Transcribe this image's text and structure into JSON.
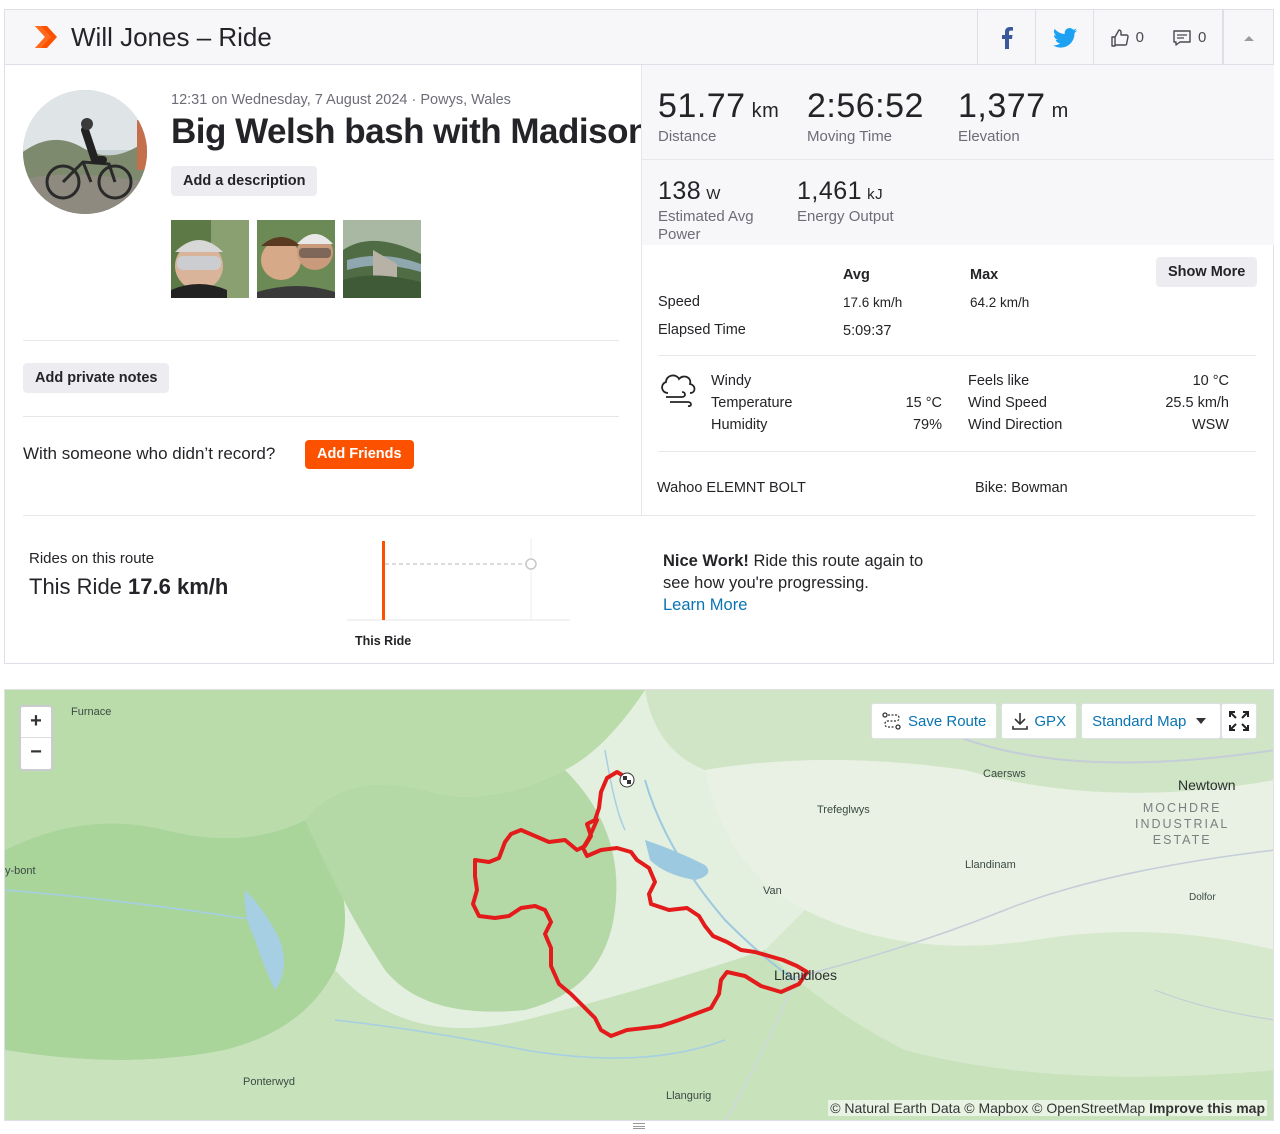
{
  "header": {
    "title": "Will Jones – Ride",
    "kudos_count": "0",
    "comments_count": "0"
  },
  "activity": {
    "meta": "12:31 on Wednesday, 7 August 2024 · Powys, Wales",
    "title": "Big Welsh bash with Madison",
    "add_description": "Add a description",
    "add_private_notes": "Add private notes",
    "friends_question": "With someone who didn’t record?",
    "add_friends": "Add Friends"
  },
  "stats": {
    "distance": {
      "value": "51.77",
      "unit": "km",
      "label": "Distance"
    },
    "moving_time": {
      "value": "2:56:52",
      "label": "Moving Time"
    },
    "elevation": {
      "value": "1,377",
      "unit": "m",
      "label": "Elevation"
    },
    "power": {
      "value": "138",
      "unit": "W",
      "label_1": "Estimated Avg",
      "label_2": "Power"
    },
    "energy": {
      "value": "1,461",
      "unit": "kJ",
      "label": "Energy Output"
    }
  },
  "more_stats": {
    "col_avg": "Avg",
    "col_max": "Max",
    "show_more": "Show More",
    "rows": [
      {
        "label": "Speed",
        "avg": "17.6 km/h",
        "max": "64.2 km/h"
      },
      {
        "label": "Elapsed Time",
        "avg": "5:09:37",
        "max": ""
      }
    ]
  },
  "weather": {
    "condition": "Windy",
    "temperature_label": "Temperature",
    "temperature": "15 °C",
    "humidity_label": "Humidity",
    "humidity": "79%",
    "feels_like_label": "Feels like",
    "feels_like": "10 °C",
    "wind_speed_label": "Wind Speed",
    "wind_speed": "25.5 km/h",
    "wind_direction_label": "Wind Direction",
    "wind_direction": "WSW"
  },
  "devices": {
    "device": "Wahoo ELEMNT BOLT",
    "bike": "Bike: Bowman"
  },
  "route": {
    "label": "Rides on this route",
    "this_ride_prefix": "This Ride",
    "this_ride_speed": "17.6 km/h",
    "chart_label": "This Ride",
    "nice_bold": "Nice Work!",
    "nice_text": " Ride this route again to see how you're progressing.",
    "learn_more": "Learn More"
  },
  "map": {
    "save_route": "Save Route",
    "gpx": "GPX",
    "map_type": "Standard Map",
    "zoom_in": "+",
    "zoom_out": "−",
    "places": {
      "furnace": "Furnace",
      "ybont": "y-bont",
      "caersws": "Caersws",
      "newtown": "Newtown",
      "mochdre_1": "MOCHDRE",
      "mochdre_2": "INDUSTRIAL",
      "mochdre_3": "ESTATE",
      "trefeglwys": "Trefeglwys",
      "llandinam": "Llandinam",
      "van": "Van",
      "dolfor": "Dolfor",
      "llanidloes": "Llanidloes",
      "ponterwyd": "Ponterwyd",
      "llangurig": "Llangurig"
    },
    "attribution_text": "© Natural Earth Data © Mapbox © OpenStreetMap ",
    "attribution_link": "Improve this map"
  },
  "colors": {
    "brand_orange": "#fc5200",
    "link_blue": "#0a74b3",
    "route_red": "#e31b1b"
  }
}
